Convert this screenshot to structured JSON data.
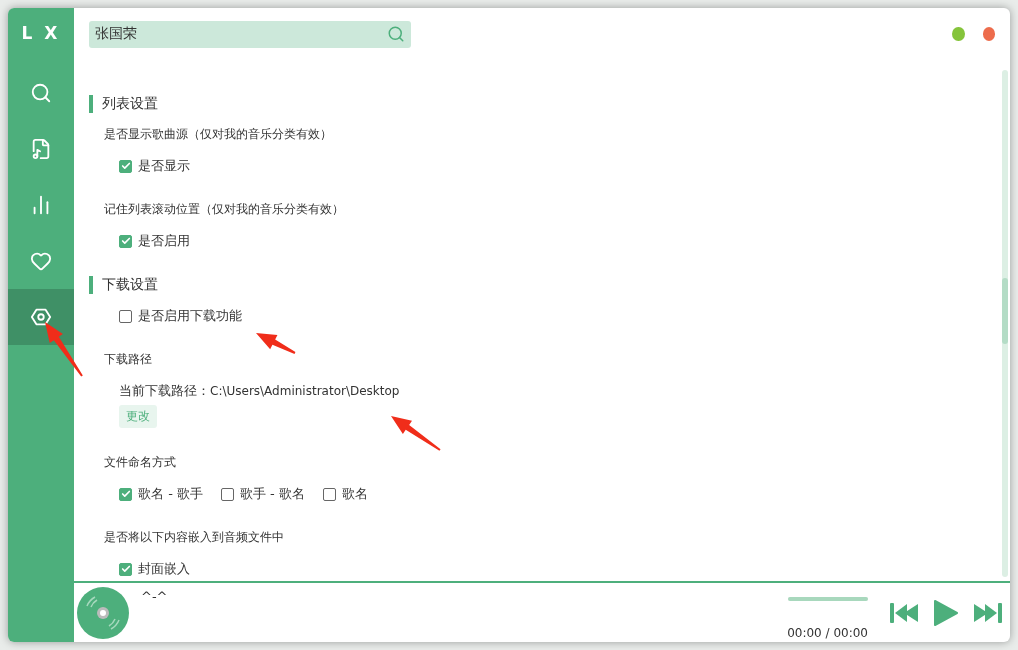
{
  "sidebar": {
    "logo": "L X",
    "items": [
      {
        "kind": "search",
        "selected": false
      },
      {
        "kind": "songlist",
        "selected": false
      },
      {
        "kind": "chart",
        "selected": false
      },
      {
        "kind": "heart",
        "selected": false
      },
      {
        "kind": "settings",
        "selected": true
      }
    ]
  },
  "search": {
    "value": "张国荣"
  },
  "sections": [
    {
      "title": "列表设置",
      "settings": [
        {
          "kind": "options",
          "label": "是否显示歌曲源（仅对我的音乐分类有效）",
          "options": [
            {
              "label": "是否显示",
              "checked": true
            }
          ]
        },
        {
          "kind": "options",
          "label": "记住列表滚动位置（仅对我的音乐分类有效）",
          "options": [
            {
              "label": "是否启用",
              "checked": true
            }
          ]
        }
      ]
    },
    {
      "title": "下载设置",
      "settings": [
        {
          "kind": "options",
          "options": [
            {
              "label": "是否启用下载功能",
              "checked": false
            }
          ]
        },
        {
          "kind": "path",
          "label": "下载路径",
          "path_label": "当前下载路径：",
          "path": "C:\\Users\\Administrator\\Desktop",
          "button": "更改"
        },
        {
          "kind": "options",
          "label": "文件命名方式",
          "options": [
            {
              "label": "歌名 - 歌手",
              "checked": true
            },
            {
              "label": "歌手 - 歌名",
              "checked": false
            },
            {
              "label": "歌名",
              "checked": false
            }
          ]
        },
        {
          "kind": "options",
          "label": "是否将以下内容嵌入到音频文件中",
          "options": [
            {
              "label": "封面嵌入",
              "checked": true
            }
          ]
        }
      ]
    }
  ],
  "player": {
    "title": "^-^",
    "time": "00:00 / 00:00",
    "volume": {
      "level": 1
    }
  }
}
